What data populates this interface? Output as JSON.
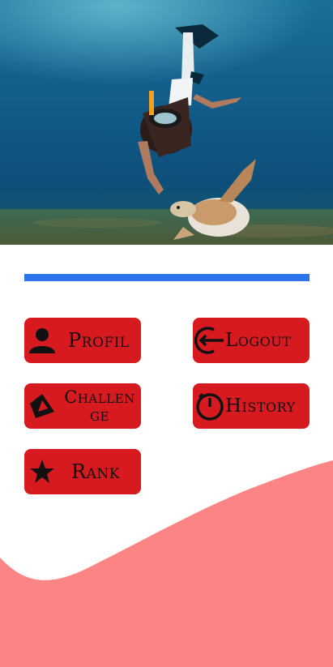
{
  "hero": {
    "description_icon": "photo-diver-turtle"
  },
  "progress": {
    "fraction": 1.0,
    "color": "#2d74ec"
  },
  "menu": {
    "profil": {
      "label": "Profil",
      "icon": "person-icon"
    },
    "logout": {
      "label": "Logout",
      "icon": "logout-icon"
    },
    "challenge": {
      "label": "Challenge",
      "icon": "challenge-icon"
    },
    "history": {
      "label": "History",
      "icon": "history-icon"
    },
    "rank": {
      "label": "Rank",
      "icon": "star-icon"
    }
  },
  "colors": {
    "button": "#d71a20",
    "wave": "#fb8585",
    "progress": "#2d74ec"
  }
}
